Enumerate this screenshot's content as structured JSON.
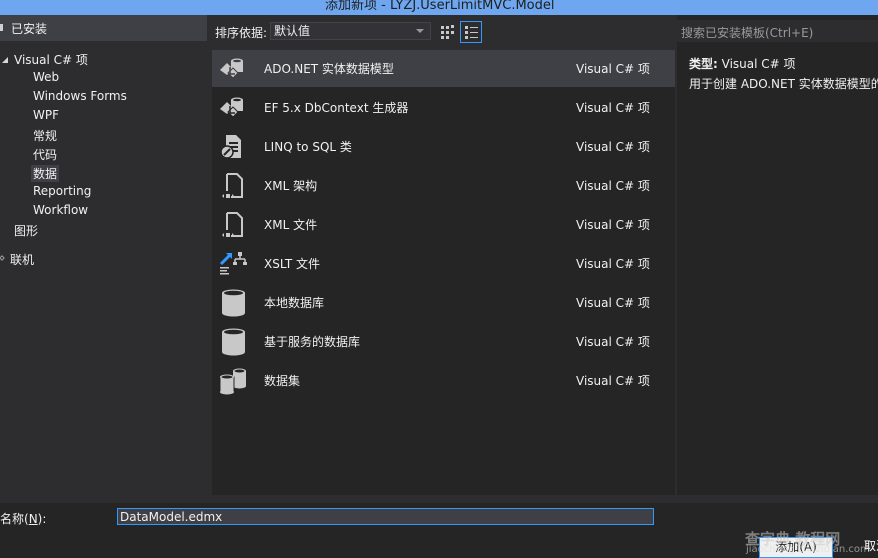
{
  "window": {
    "title": "添加新项 - LYZJ.UserLimitMVC.Model"
  },
  "sidebar": {
    "installed_label": "已安装",
    "items": [
      {
        "label": "Visual C# 项",
        "level": 0,
        "expanded": true
      },
      {
        "label": "Web",
        "level": 1
      },
      {
        "label": "Windows Forms",
        "level": 1
      },
      {
        "label": "WPF",
        "level": 1
      },
      {
        "label": "常规",
        "level": 1
      },
      {
        "label": "代码",
        "level": 1
      },
      {
        "label": "数据",
        "level": 1,
        "selected": true
      },
      {
        "label": "Reporting",
        "level": 1
      },
      {
        "label": "Workflow",
        "level": 1
      },
      {
        "label": "图形",
        "level": 0
      }
    ],
    "online_label": "联机"
  },
  "toolbar": {
    "sort_label": "排序依据:",
    "sort_value": "默认值",
    "view_grid_icon": "small-icons-view-icon",
    "view_list_icon": "list-view-icon"
  },
  "templates": [
    {
      "name": "ADO.NET 实体数据模型",
      "type": "Visual C# 项",
      "icon": "entity-model-icon",
      "selected": true
    },
    {
      "name": "EF 5.x DbContext 生成器",
      "type": "Visual C# 项",
      "icon": "dbcontext-generator-icon"
    },
    {
      "name": "LINQ to SQL 类",
      "type": "Visual C# 项",
      "icon": "linq-to-sql-icon"
    },
    {
      "name": "XML 架构",
      "type": "Visual C# 项",
      "icon": "xml-schema-icon"
    },
    {
      "name": "XML 文件",
      "type": "Visual C# 项",
      "icon": "xml-file-icon"
    },
    {
      "name": "XSLT 文件",
      "type": "Visual C# 项",
      "icon": "xslt-file-icon"
    },
    {
      "name": "本地数据库",
      "type": "Visual C# 项",
      "icon": "database-icon"
    },
    {
      "name": "基于服务的数据库",
      "type": "Visual C# 项",
      "icon": "database-icon"
    },
    {
      "name": "数据集",
      "type": "Visual C# 项",
      "icon": "dataset-icon"
    }
  ],
  "details": {
    "search_placeholder": "搜索已安装模板(Ctrl+E)",
    "type_label": "类型:",
    "type_value": "Visual C# 项",
    "description": "用于创建 ADO.NET 实体数据模型的项。"
  },
  "footer": {
    "name_label_prefix": "名称(",
    "name_label_key": "N",
    "name_label_suffix": "):",
    "name_value": "DataModel.edmx",
    "add_button": "添加(A)",
    "cancel_button": "取消"
  },
  "watermark": {
    "text": "查字典 教程网",
    "sub": "jiaocheng.chazidian.com"
  }
}
